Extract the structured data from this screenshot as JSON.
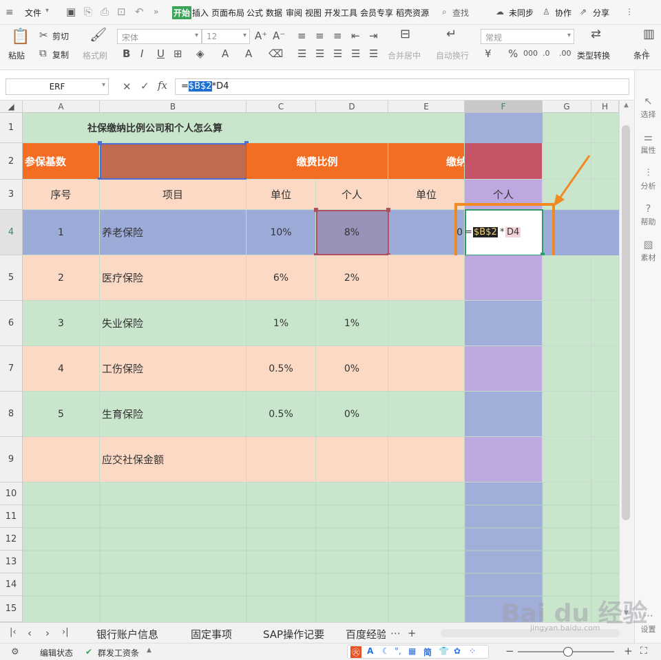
{
  "menubar": {
    "file": "文件",
    "more": "»",
    "tabs": [
      "开始",
      "插入",
      "页面布局",
      "公式",
      "数据",
      "审阅",
      "视图",
      "开发工具",
      "会员专享",
      "稻壳资源"
    ],
    "search": "查找",
    "sync": "未同步",
    "collab": "协作",
    "share": "分享"
  },
  "ribbon": {
    "paste": "粘贴",
    "cut": "剪切",
    "copy": "复制",
    "format_painter": "格式刷",
    "font_name": "宋体",
    "font_size": "12",
    "merge_center": "合并居中",
    "wrap": "自动换行",
    "number_format": "常规",
    "type_convert": "类型转换",
    "cond_format": "条件"
  },
  "formula_bar": {
    "name_box": "ERF",
    "fx": "fx",
    "formula_prefix": "=",
    "formula_ref": "$B$2",
    "formula_suffix": "*D4"
  },
  "columns": [
    "A",
    "B",
    "C",
    "D",
    "E",
    "F",
    "G",
    "H"
  ],
  "rows": [
    "1",
    "2",
    "3",
    "4",
    "5",
    "6",
    "7",
    "8",
    "9",
    "10",
    "11",
    "12",
    "13",
    "14",
    "15"
  ],
  "sheet": {
    "title": "社保缴纳比例公司和个人怎么算",
    "base_label": "参保基数",
    "ratio_label": "缴费比例",
    "amount_label": "缴纳金额",
    "h_seq": "序号",
    "h_item": "项目",
    "h_unit": "单位",
    "h_person": "个人",
    "h_unit2": "单位",
    "h_person2": "个人",
    "items": [
      {
        "seq": "1",
        "name": "养老保险",
        "unit": "10%",
        "person": "8%"
      },
      {
        "seq": "2",
        "name": "医疗保险",
        "unit": "6%",
        "person": "2%"
      },
      {
        "seq": "3",
        "name": "失业保险",
        "unit": "1%",
        "person": "1%"
      },
      {
        "seq": "4",
        "name": "工伤保险",
        "unit": "0.5%",
        "person": "0%"
      },
      {
        "seq": "5",
        "name": "生育保险",
        "unit": "0.5%",
        "person": "0%"
      }
    ],
    "total_label": "应交社保金额",
    "e4_value": "0",
    "edit_eq": "=",
    "edit_ref": "$B$2",
    "edit_op": "*",
    "edit_ref2": "D4"
  },
  "sidebar": [
    "选择",
    "属性",
    "分析",
    "帮助",
    "素材",
    "设置"
  ],
  "sheet_tabs": [
    "银行账户信息",
    "固定事项",
    "SAP操作记要",
    "百度经验"
  ],
  "status": {
    "mode": "编辑状态",
    "app": "群发工资条",
    "jian": "简"
  },
  "watermark": "Bai du 经验",
  "watermark_url": "jingyan.baidu.com",
  "colors": {
    "green": "#c9e6cc",
    "orange": "#f36d22",
    "peach": "#fcd9c5",
    "blue_row": "#9cabd8",
    "col_f_blue": "#a0aed9",
    "col_f_purple": "#bfa8df",
    "accent_box": "#f18a22"
  }
}
